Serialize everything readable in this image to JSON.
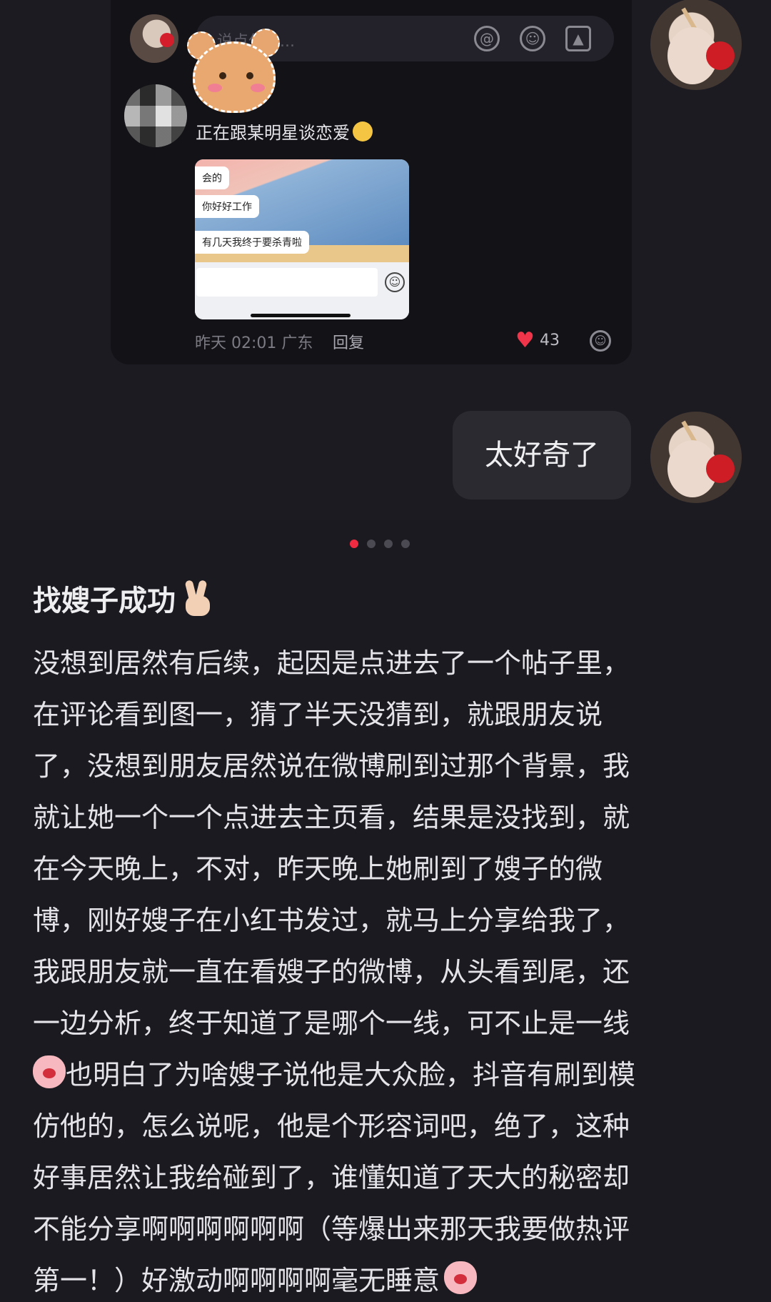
{
  "comment": {
    "input_placeholder": "说点什么...",
    "text": "正在跟某明星谈恋爱",
    "attachment_bubbles": [
      "会的",
      "你好好工作",
      "有几天我终于要杀青啦"
    ],
    "time_location": "昨天 02:01 广东",
    "reply_label": "回复",
    "like_count": "43"
  },
  "reply": {
    "text": "太好奇了"
  },
  "carousel": {
    "total": 4,
    "active_index": 0
  },
  "post": {
    "title": "找嫂子成功",
    "lines": [
      "没想到居然有后续，起因是点进去了一个帖子里，",
      "在评论看到图一，猜了半天没猜到，就跟朋友说",
      "了，没想到朋友居然说在微博刷到过那个背景，我",
      "就让她一个一个点进去主页看，结果是没找到，就",
      "在今天晚上，不对，昨天晚上她刷到了嫂子的微",
      "博，刚好嫂子在小红书发过，就马上分享给我了，",
      "我跟朋友就一直在看嫂子的微博，从头看到尾，还",
      "一边分析，终于知道了是哪个一线，可不止是一线",
      "也明白了为啥嫂子说他是大众脸，抖音有刷到模",
      "仿他的，怎么说呢，他是个形容词吧，绝了，这种",
      "好事居然让我给碰到了，谁懂知道了天大的秘密却",
      "不能分享啊啊啊啊啊啊（等爆出来那天我要做热评",
      "第一！）好激动啊啊啊啊毫无睡意"
    ]
  },
  "icons": {
    "mention": "at-icon",
    "emoji": "smiley-icon",
    "image": "image-icon",
    "like": "heart-icon",
    "peace": "victory-hand-icon",
    "peach": "peach-face-icon"
  },
  "colors": {
    "background": "#1b1a20",
    "like": "#f0344a",
    "active_dot": "#ee2b41"
  }
}
